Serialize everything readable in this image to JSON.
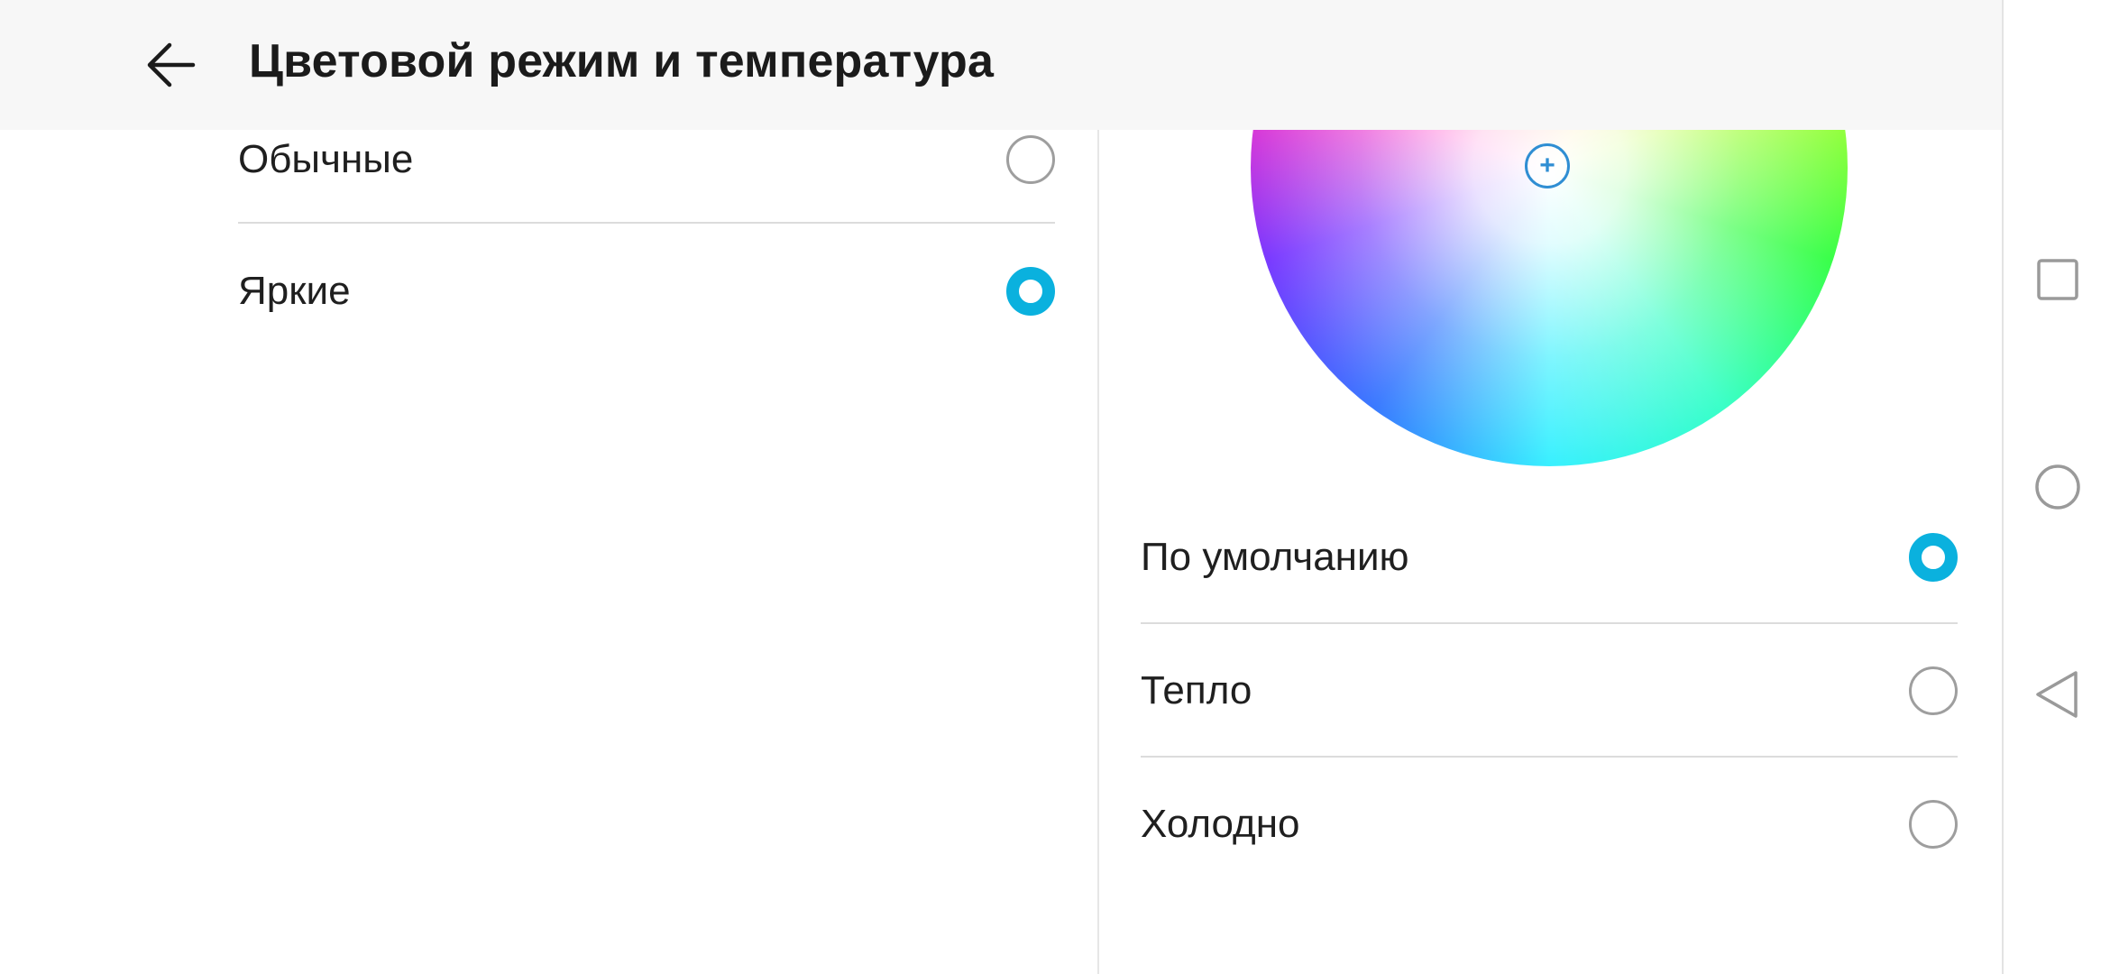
{
  "header": {
    "title": "Цветовой режим и температура",
    "back_icon": "arrow-left-icon"
  },
  "color_mode": {
    "options": [
      {
        "label": "Обычные",
        "selected": false
      },
      {
        "label": "Яркие",
        "selected": true
      }
    ]
  },
  "color_temperature": {
    "wheel_marker_symbol": "+",
    "options": [
      {
        "label": "По умолчанию",
        "selected": true
      },
      {
        "label": "Тепло",
        "selected": false
      },
      {
        "label": "Холодно",
        "selected": false
      }
    ]
  },
  "navigation_bar": {
    "buttons": [
      "recents-square-icon",
      "home-circle-icon",
      "back-triangle-icon"
    ]
  },
  "colors": {
    "accent": "#0ab1de",
    "header_bg": "#f7f7f7",
    "marker": "#2f8ed3"
  }
}
